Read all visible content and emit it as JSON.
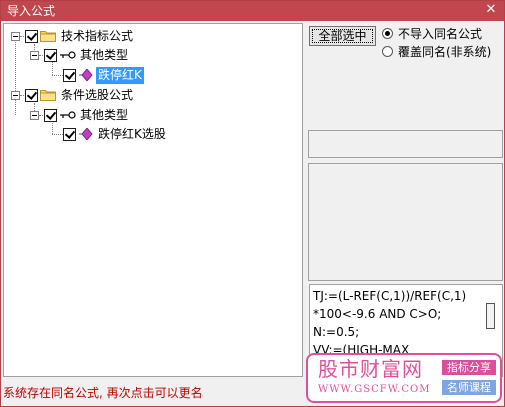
{
  "window": {
    "title": "导入公式",
    "close_glyph": "✕"
  },
  "tree": {
    "nodes": [
      {
        "label": "技术指标公式",
        "icon": "folder-icon",
        "checked": true
      },
      {
        "label": "其他类型",
        "icon": "key-icon",
        "checked": true
      },
      {
        "label": "跌停红K",
        "icon": "diamond-formula-icon",
        "checked": true,
        "selected": true
      },
      {
        "label": "条件选股公式",
        "icon": "folder-icon",
        "checked": true
      },
      {
        "label": "其他类型",
        "icon": "key-icon",
        "checked": true
      },
      {
        "label": "跌停红K选股",
        "icon": "diamond-formula-icon",
        "checked": true
      }
    ]
  },
  "options": {
    "select_all_label": "全部选中",
    "radio_skip_label": "不导入同名公式",
    "radio_overwrite_label": "覆盖同名(非系统)",
    "selected": "skip"
  },
  "formula": {
    "lines": [
      "TJ:=(L-REF(C,1))/REF(C,1)",
      "*100<-9.6 AND C>O;",
      "N:=0.5;",
      "VV:=(HIGH-MAX"
    ]
  },
  "status_text": "系统存在同名公式, 再次点击可以更名",
  "watermark": {
    "site_name": "股市财富网",
    "url": "WWW.GSCFW.COM",
    "badge_top": "指标分享",
    "badge_bottom": "名师课程"
  },
  "colors": {
    "titlebar": "#c0474e",
    "selection": "#3399ff",
    "status_text": "#c00000",
    "watermark_pink": "#e0509a",
    "badge_top_bg": "#d9509a",
    "badge_bottom_bg": "#7fa6e0"
  }
}
